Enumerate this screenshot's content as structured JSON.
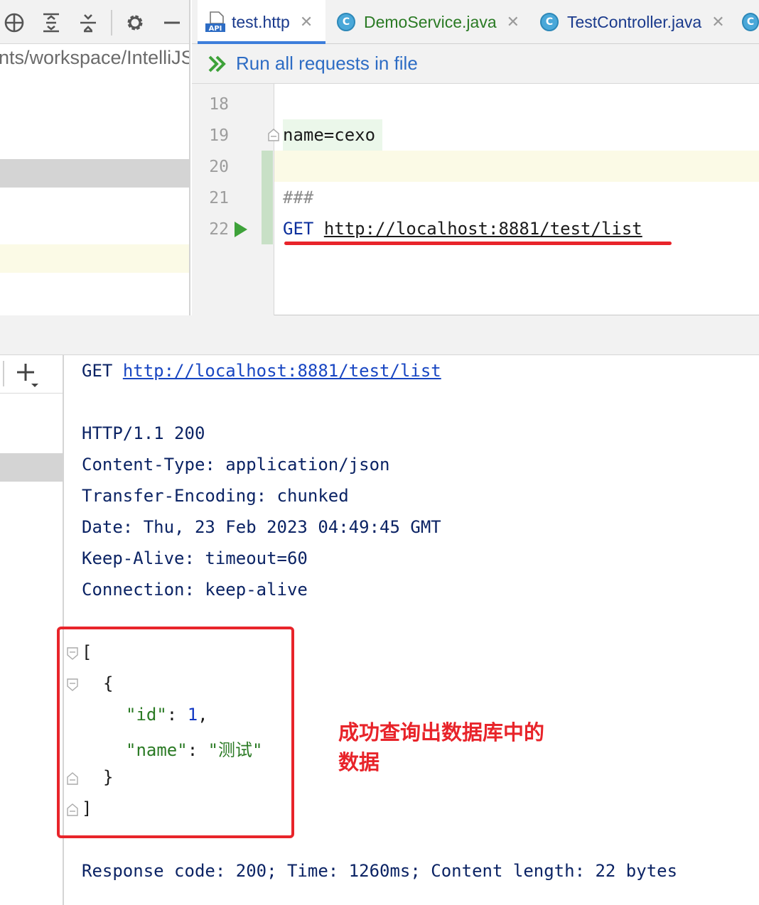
{
  "project": {
    "path_text": "nts/workspace/IntelliJS"
  },
  "toolbar": {
    "icons": [
      "crosshair-icon",
      "expand-all-icon",
      "collapse-all-icon",
      "gear-icon",
      "minimize-icon"
    ]
  },
  "tabs": [
    {
      "label": "test.http",
      "icon": "api-file-icon",
      "active": true
    },
    {
      "label": "DemoService.java",
      "icon": "class-icon",
      "color": "#2a7a24"
    },
    {
      "label": "TestController.java",
      "icon": "class-icon",
      "color": "#1a3a8c"
    }
  ],
  "run_bar": {
    "label": "Run all requests in file"
  },
  "editor": {
    "line_numbers": [
      "18",
      "19",
      "20",
      "21",
      "22"
    ],
    "lines": {
      "l19": "name=cexo",
      "l21": "###",
      "l22_method": "GET",
      "l22_url": "http://localhost:8881/test/list"
    }
  },
  "output": {
    "request_method": "GET",
    "request_url": "http://localhost:8881/test/list",
    "status_line": "HTTP/1.1 200",
    "headers": [
      "Content-Type: application/json",
      "Transfer-Encoding: chunked",
      "Date: Thu, 23 Feb 2023 04:49:45 GMT",
      "Keep-Alive: timeout=60",
      "Connection: keep-alive"
    ],
    "json": {
      "open_bracket": "[",
      "open_brace": "{",
      "id_key": "\"id\"",
      "id_value": "1",
      "name_key": "\"name\"",
      "name_value": "\"测试\"",
      "close_brace": "}",
      "close_bracket": "]"
    },
    "summary": "Response code: 200; Time: 1260ms; Content length: 22 bytes"
  },
  "annotation": {
    "text": "成功查询出数据库中的数据"
  },
  "colors": {
    "accent": "#3d7edb",
    "run_text": "#2d6cc4",
    "annotation_red": "#e8242a"
  }
}
